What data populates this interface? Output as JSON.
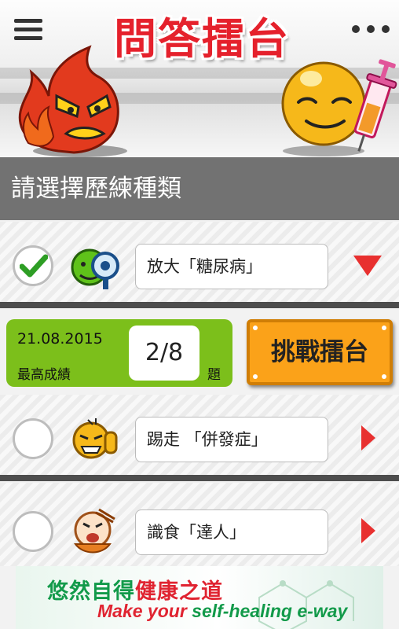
{
  "header": {
    "title": "問答擂台",
    "menu_icon": "hamburger-menu-icon",
    "more_icon": "overflow-dots-icon"
  },
  "section": {
    "title": "請選擇歷練種類"
  },
  "categories": [
    {
      "label": "放大「糖尿病」",
      "selected": true,
      "icon": "magnifier-smiley-icon",
      "indicator": "expand-down-icon"
    },
    {
      "label": "踢走 「併發症」",
      "selected": false,
      "icon": "fighting-smiley-icon",
      "indicator": "chevron-right-icon"
    },
    {
      "label": "識食「達人」",
      "selected": false,
      "icon": "eating-smiley-icon",
      "indicator": "chevron-right-icon"
    }
  ],
  "score": {
    "date": "21.08.2015",
    "caption": "最高成績",
    "value": "2/8",
    "unit": "題"
  },
  "challenge_button": {
    "label": "挑戰擂台"
  },
  "ad": {
    "line1_green": "悠然自得",
    "line1_red": "健康之道",
    "line2_red": "Make your ",
    "line2_green": "self-healing e-way"
  },
  "colors": {
    "title_red": "#e5212c",
    "section_gray": "#727272",
    "score_green": "#7cbf1b",
    "challenge_orange": "#fba219",
    "arrow_red": "#e8302f",
    "ad_green": "#129a4a"
  }
}
